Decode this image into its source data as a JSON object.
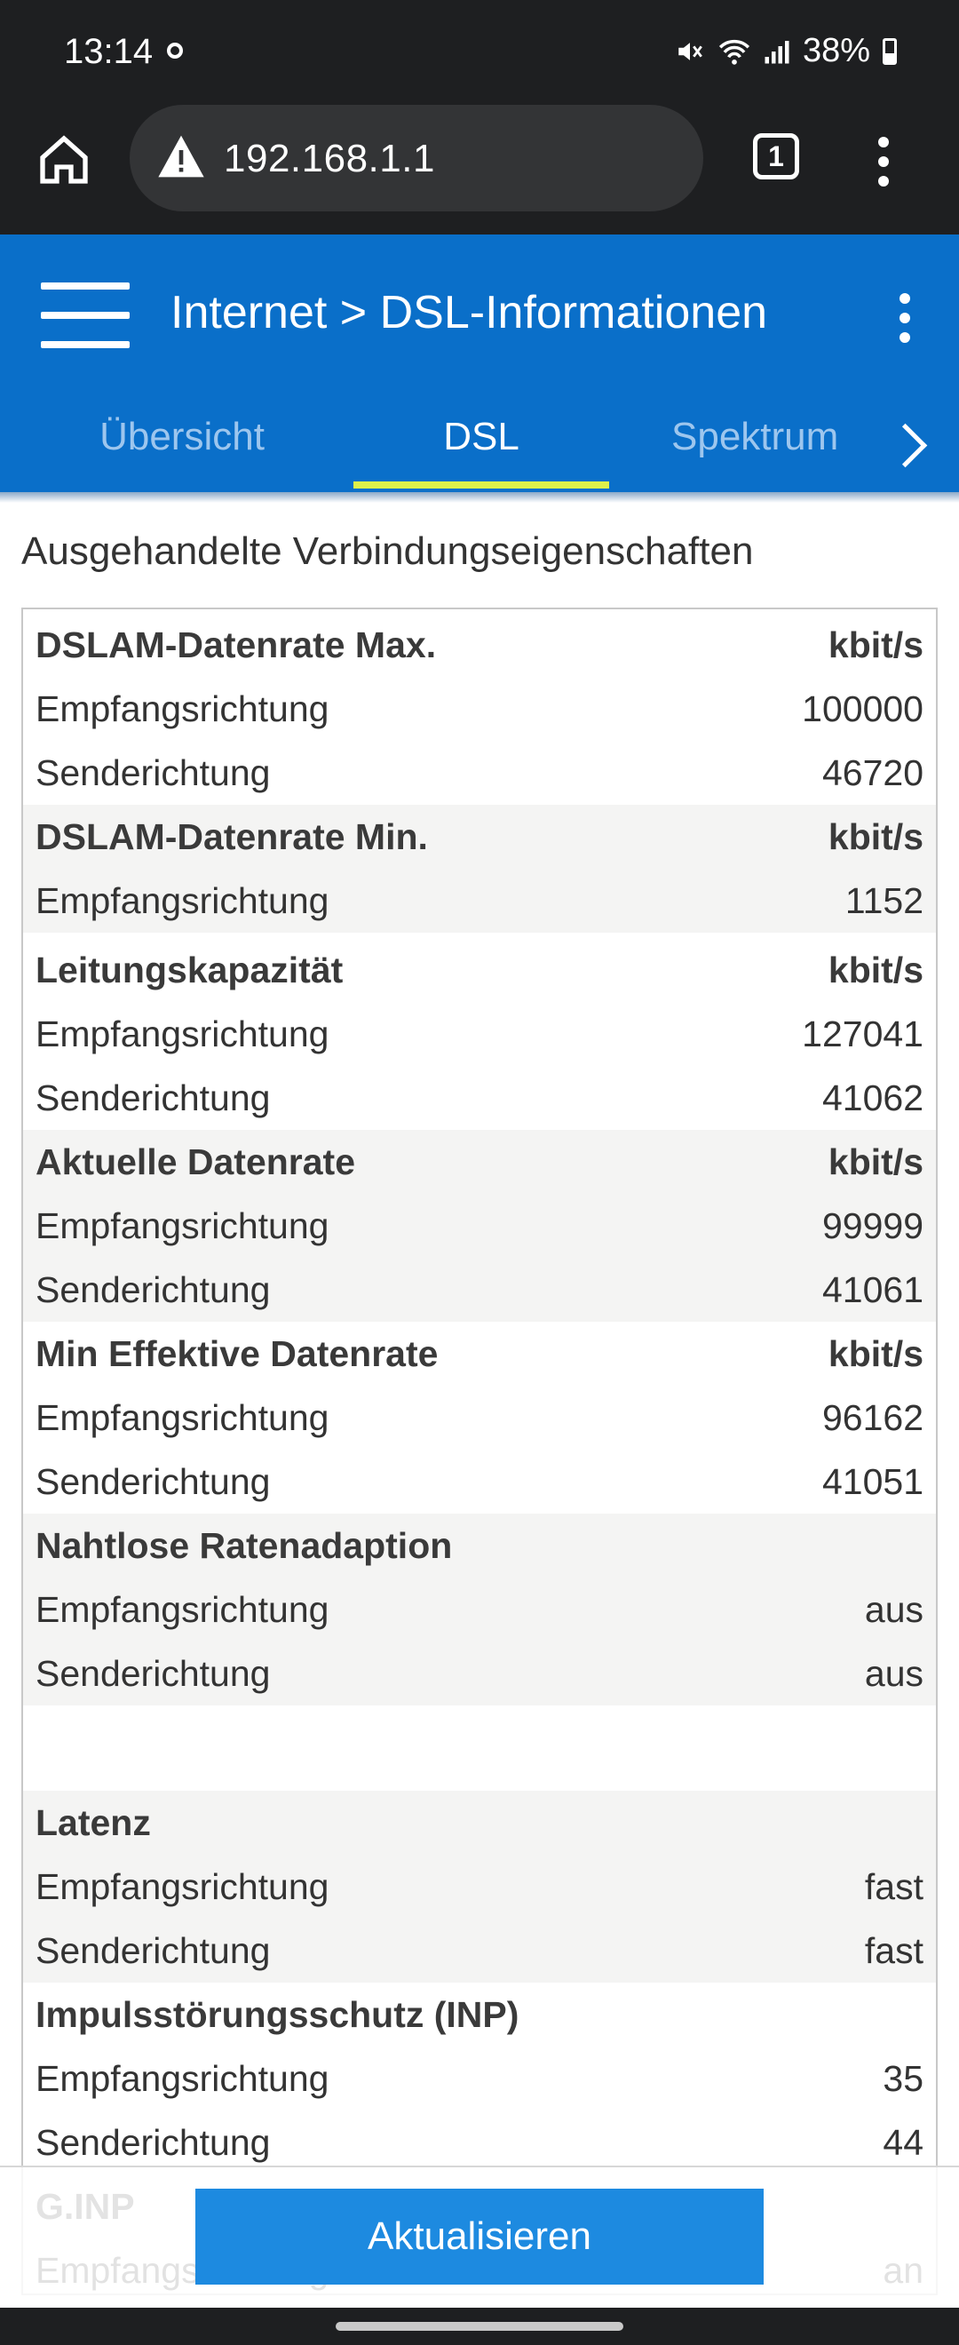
{
  "status_bar": {
    "time": "13:14",
    "battery": "38%"
  },
  "browser": {
    "url": "192.168.1.1",
    "tab_count": "1"
  },
  "header": {
    "breadcrumb": "Internet > DSL-Informationen",
    "tabs": [
      {
        "label": "Übersicht",
        "active": false
      },
      {
        "label": "DSL",
        "active": true
      },
      {
        "label": "Spektrum",
        "active": false
      }
    ]
  },
  "section_title": "Ausgehandelte Verbindungseigenschaften",
  "rows": [
    {
      "type": "head",
      "label": "DSLAM-Datenrate Max.",
      "value": "kbit/s"
    },
    {
      "type": "row",
      "label": "Empfangsrichtung",
      "value": "100000"
    },
    {
      "type": "row",
      "label": "Senderichtung",
      "value": "46720"
    },
    {
      "type": "head",
      "label": "DSLAM-Datenrate Min.",
      "value": "kbit/s"
    },
    {
      "type": "row",
      "label": "Empfangsrichtung",
      "value": "1152"
    },
    {
      "type": "head",
      "label": "Leitungskapazität",
      "value": "kbit/s"
    },
    {
      "type": "row",
      "label": "Empfangsrichtung",
      "value": "127041"
    },
    {
      "type": "row",
      "label": "Senderichtung",
      "value": "41062"
    },
    {
      "type": "head",
      "label": "Aktuelle Datenrate",
      "value": "kbit/s"
    },
    {
      "type": "row",
      "label": "Empfangsrichtung",
      "value": "99999"
    },
    {
      "type": "row",
      "label": "Senderichtung",
      "value": "41061"
    },
    {
      "type": "head",
      "label": "Min Effektive Datenrate",
      "value": "kbit/s"
    },
    {
      "type": "row",
      "label": "Empfangsrichtung",
      "value": "96162"
    },
    {
      "type": "row",
      "label": "Senderichtung",
      "value": "41051"
    },
    {
      "type": "head",
      "label": "Nahtlose Ratenadaption",
      "value": ""
    },
    {
      "type": "row",
      "label": "Empfangsrichtung",
      "value": "aus"
    },
    {
      "type": "row",
      "label": "Senderichtung",
      "value": "aus"
    },
    {
      "type": "head",
      "label": "Latenz",
      "value": ""
    },
    {
      "type": "row",
      "label": "Empfangsrichtung",
      "value": "fast"
    },
    {
      "type": "row",
      "label": "Senderichtung",
      "value": "fast"
    },
    {
      "type": "head",
      "label": "Impulsstörungsschutz (INP)",
      "value": ""
    },
    {
      "type": "row",
      "label": "Empfangsrichtung",
      "value": "35"
    },
    {
      "type": "row",
      "label": "Senderichtung",
      "value": "44"
    },
    {
      "type": "head",
      "label": "G.INP",
      "value": ""
    },
    {
      "type": "row",
      "label": "Empfangsrichtung",
      "value": "an"
    }
  ],
  "update_button": "Aktualisieren",
  "colors": {
    "header_blue": "#0a6fc9",
    "tab_indicator": "#dff04a",
    "button_blue": "#1d8ae0"
  }
}
